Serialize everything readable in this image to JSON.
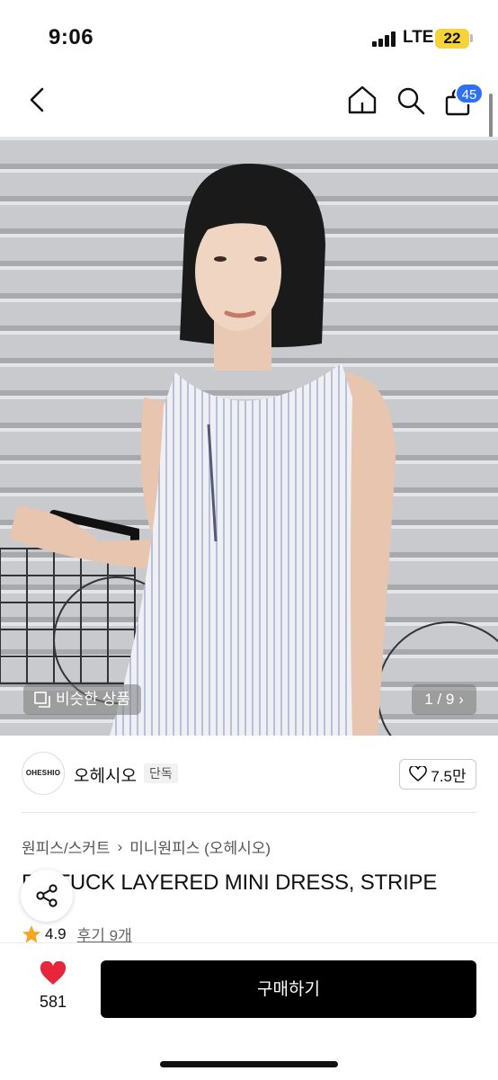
{
  "status_bar": {
    "time": "9:06",
    "network": "LTE",
    "battery": "22"
  },
  "nav": {
    "cart_count": "45",
    "icons": [
      "back-arrow-icon",
      "home-icon",
      "search-icon",
      "shopping-bag-icon"
    ]
  },
  "hero": {
    "similar_label": "비슷한 상품",
    "image_counter": "1 / 9",
    "counter_icon": "chevron-right-icon"
  },
  "shop": {
    "logo_text": "OHESHIO",
    "name": "오헤시오",
    "tag": "단독",
    "likes": "7.5만"
  },
  "product": {
    "breadcrumb": [
      "원피스/스커트",
      "미니원피스 (오헤시오)"
    ],
    "title": "PINTUCK LAYERED MINI DRESS, STRIPE",
    "rating": "4.9",
    "reviews": "후기 9개"
  },
  "bottom_bar": {
    "wish_count": "581",
    "buy_label": "구매하기"
  },
  "colors": {
    "accent": "#2f6ff1",
    "heart": "#e8263b",
    "star": "#f5a623",
    "buy_button": "#000000"
  }
}
